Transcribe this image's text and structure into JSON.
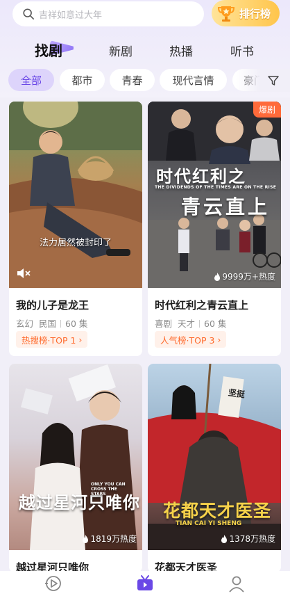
{
  "search": {
    "placeholder": "吉祥如意过大年"
  },
  "rank_button": {
    "label": "排行榜"
  },
  "tabs": [
    {
      "label": "找剧"
    },
    {
      "label": "新剧"
    },
    {
      "label": "热播"
    },
    {
      "label": "听书"
    }
  ],
  "chips": [
    {
      "label": "全部"
    },
    {
      "label": "都市"
    },
    {
      "label": "青春"
    },
    {
      "label": "现代言情"
    },
    {
      "label": "豪门"
    }
  ],
  "cards": [
    {
      "title": "我的儿子是龙王",
      "tag1": "玄幻",
      "tag2": "民国",
      "episodes": "60 集",
      "rank": "热搜榜·TOP 1",
      "caption": "法力居然被封印了"
    },
    {
      "title": "时代红利之青云直上",
      "tag1": "喜剧",
      "tag2": "天才",
      "episodes": "60 集",
      "rank": "人气榜·TOP 3",
      "hot": "爆剧",
      "heat": "9999万+热度",
      "poster_title_1": "时代红利之",
      "poster_subtitle": "THE DIVIDENDS OF THE TIMES ARE ON THE RISE",
      "poster_title_2": "青云直上"
    },
    {
      "title": "越过星河只唯你",
      "heat": "1819万热度",
      "poster_title": "越过星河只唯你",
      "poster_subtitle": "ONLY YOU CAN CROSS THE STARS"
    },
    {
      "title": "花都天才医圣",
      "heat": "1378万热度",
      "poster_title": "花都天才医圣",
      "poster_subtitle": "TIAN CAI YI SHENG",
      "sign": "坚挺"
    }
  ],
  "colors": {
    "accent": "#6a48e6",
    "chip_active_bg": "#ddd4fb",
    "rank_text": "#ff6a2c",
    "hot_tag": "#ff6a3a"
  },
  "icons": {
    "search": "search-icon",
    "trophy": "trophy-icon",
    "filter": "filter-icon",
    "mute": "mute-icon",
    "flame": "flame-icon",
    "nav_home": "nav-discover-icon",
    "nav_theater": "nav-theater-icon",
    "nav_profile": "nav-profile-icon"
  }
}
